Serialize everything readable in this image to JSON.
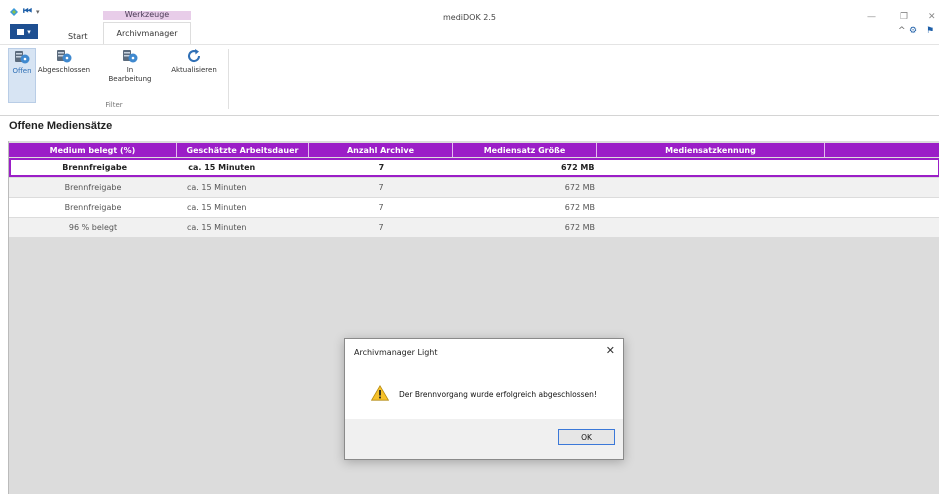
{
  "window": {
    "title": "mediDOK 2.5",
    "context_group": "Werkzeuge"
  },
  "tabs": {
    "start": "Start",
    "archivmanager": "Archivmanager"
  },
  "ribbon": {
    "offen": "Offen",
    "abgeschlossen": "Abgeschlossen",
    "in_bearbeitung_line1": "In",
    "in_bearbeitung_line2": "Bearbeitung",
    "aktualisieren": "Aktualisieren",
    "group_label": "Filter"
  },
  "section_title": "Offene Mediensätze",
  "table": {
    "columns": [
      "Medium belegt (%)",
      "Geschätzte Arbeitsdauer",
      "Anzahl Archive",
      "Mediensatz Größe",
      "Mediensatzkennung",
      ""
    ],
    "rows": [
      [
        "Brennfreigabe",
        "ca. 15 Minuten",
        "7",
        "672 MB",
        ""
      ],
      [
        "Brennfreigabe",
        "ca. 15 Minuten",
        "7",
        "672 MB",
        ""
      ],
      [
        "Brennfreigabe",
        "ca. 15 Minuten",
        "7",
        "672 MB",
        ""
      ],
      [
        "96 % belegt",
        "ca. 15 Minuten",
        "7",
        "672 MB",
        ""
      ]
    ],
    "selected_row": 0
  },
  "dialog": {
    "title": "Archivmanager Light",
    "message": "Der Brennvorgang wurde erfolgreich abgeschlossen!",
    "ok_label": "OK",
    "close_glyph": "✕"
  },
  "colors": {
    "accent": "#9b1ec7",
    "file_button": "#1e4f91",
    "context_tab": "#e8cde9"
  },
  "icons": {
    "qa": [
      "app-logo-icon",
      "navigate-icon",
      "dropdown-icon"
    ],
    "window": [
      "minimize-icon",
      "maximize-icon",
      "close-icon"
    ],
    "tray": [
      "collapse-ribbon-icon",
      "settings-gear-icon",
      "flag-icon"
    ],
    "ribbon": [
      "disc-filter-icon",
      "refresh-icon"
    ],
    "dialog": "warning-icon"
  }
}
